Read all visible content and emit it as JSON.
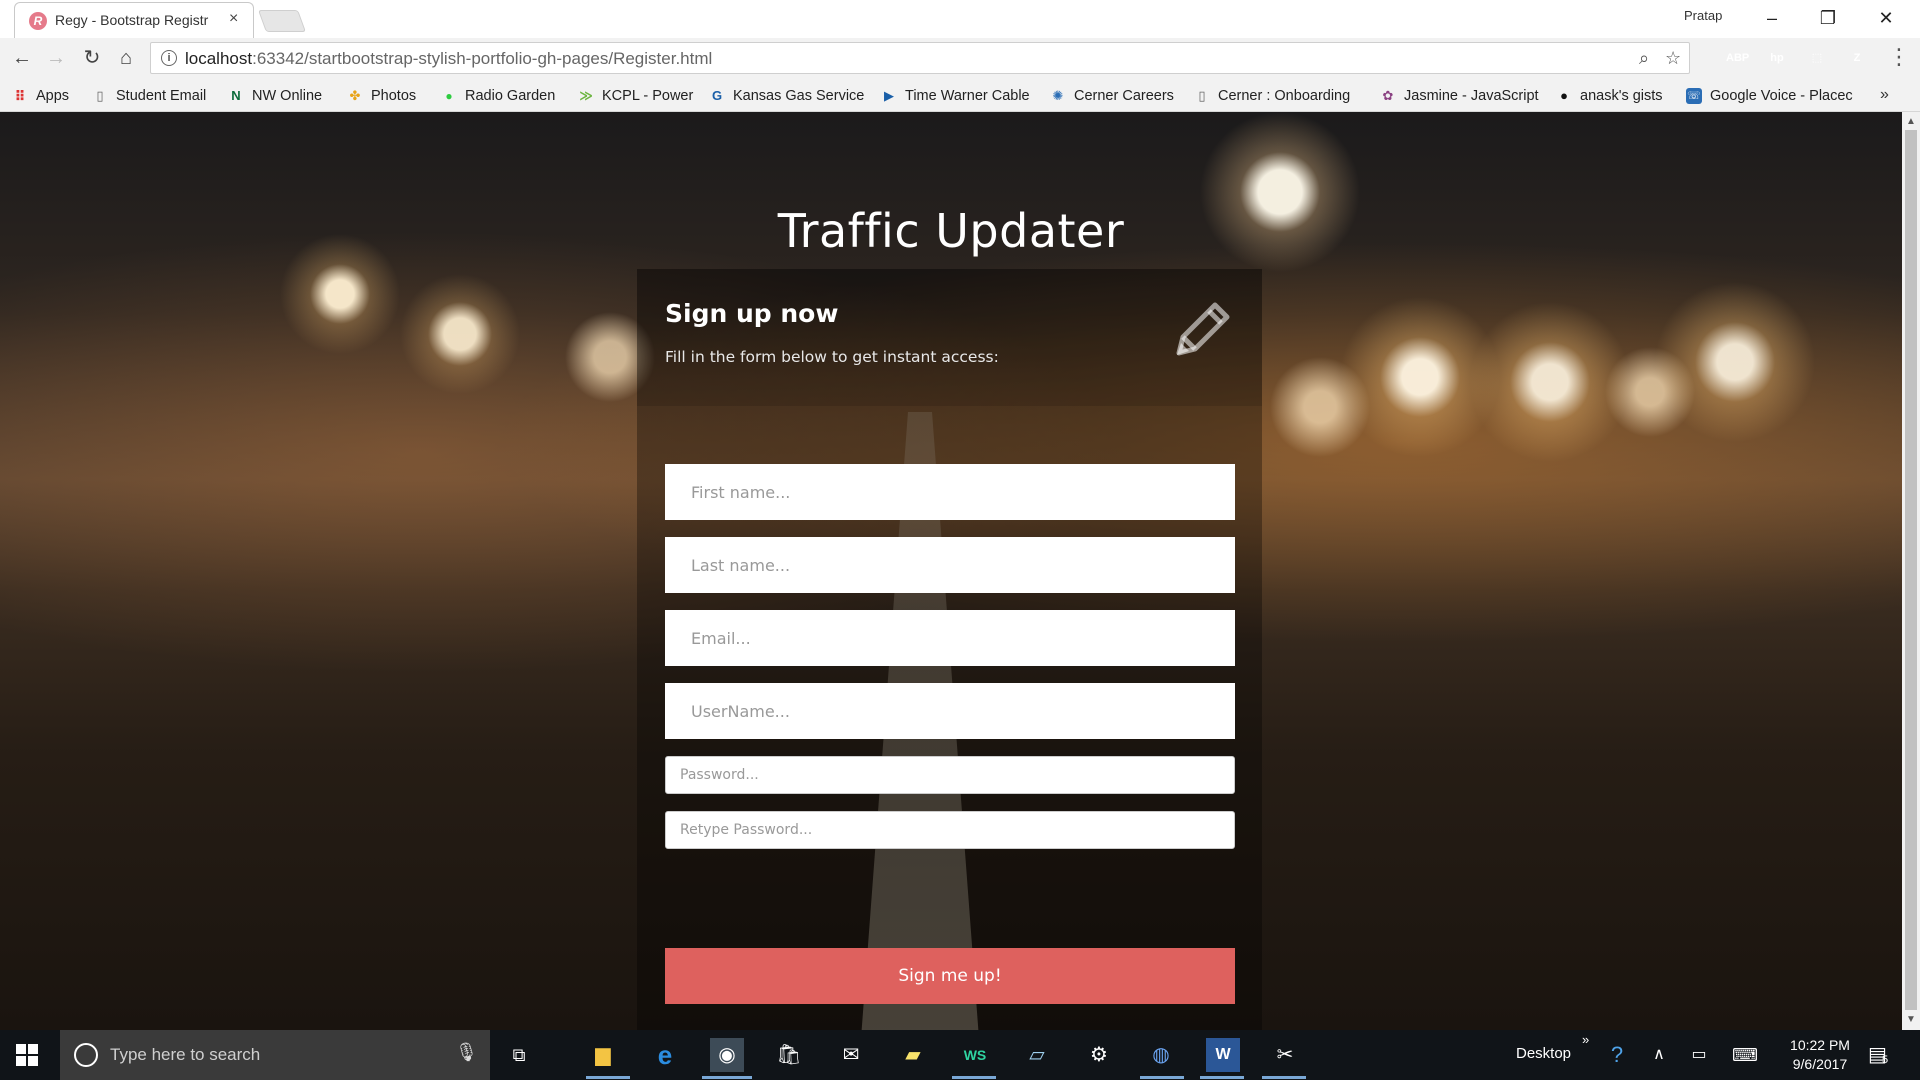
{
  "browser": {
    "tab_title": "Regy - Bootstrap Registr",
    "tab_favicon": "R",
    "tab_close": "×",
    "profile_name": "Pratap",
    "url_host": "localhost",
    "url_rest": ":63342/startbootstrap-stylish-portfolio-gh-pages/Register.html",
    "bookmarks": [
      {
        "label": "Apps",
        "icon": "apps-grid-icon"
      },
      {
        "label": "Student Email",
        "icon": "page-icon"
      },
      {
        "label": "NW Online",
        "icon": "nw-logo-icon"
      },
      {
        "label": "Photos",
        "icon": "photos-pinwheel-icon"
      },
      {
        "label": "Radio Garden",
        "icon": "green-dot-icon"
      },
      {
        "label": "KCPL - Power",
        "icon": "kcpl-logo-icon"
      },
      {
        "label": "Kansas Gas Service",
        "icon": "gas-logo-icon"
      },
      {
        "label": "Time Warner Cable",
        "icon": "play-arrow-icon"
      },
      {
        "label": "Cerner Careers",
        "icon": "cerner-icon"
      },
      {
        "label": "Cerner : Onboarding",
        "icon": "page-icon"
      },
      {
        "label": "Jasmine - JavaScript",
        "icon": "jasmine-icon"
      },
      {
        "label": "anask's gists",
        "icon": "github-icon"
      },
      {
        "label": "Google Voice - Placec",
        "icon": "google-voice-icon"
      }
    ],
    "bookmarks_more": "»",
    "extensions": [
      {
        "label": "ABP",
        "color": "#c70d2c"
      },
      {
        "label": "hp",
        "color": "#1a8ad8"
      },
      {
        "label": "⬚",
        "color": "#b9b9b9"
      },
      {
        "label": "Z",
        "color": "#3b5aa8"
      }
    ]
  },
  "page": {
    "app_title": "Traffic Updater",
    "heading": "Sign up now",
    "subheading": "Fill in the form below to get instant access:",
    "fields": {
      "first_name": "First name...",
      "last_name": "Last name...",
      "email": "Email...",
      "username": "UserName...",
      "password": "Password...",
      "retype_password": "Retype Password..."
    },
    "submit_label": "Sign me up!",
    "submit_color": "#de615e"
  },
  "taskbar": {
    "search_placeholder": "Type here to search",
    "desktop_label": "Desktop",
    "desktop_more": "»",
    "time": "10:22 PM",
    "date": "9/6/2017",
    "notification_count": "5"
  }
}
